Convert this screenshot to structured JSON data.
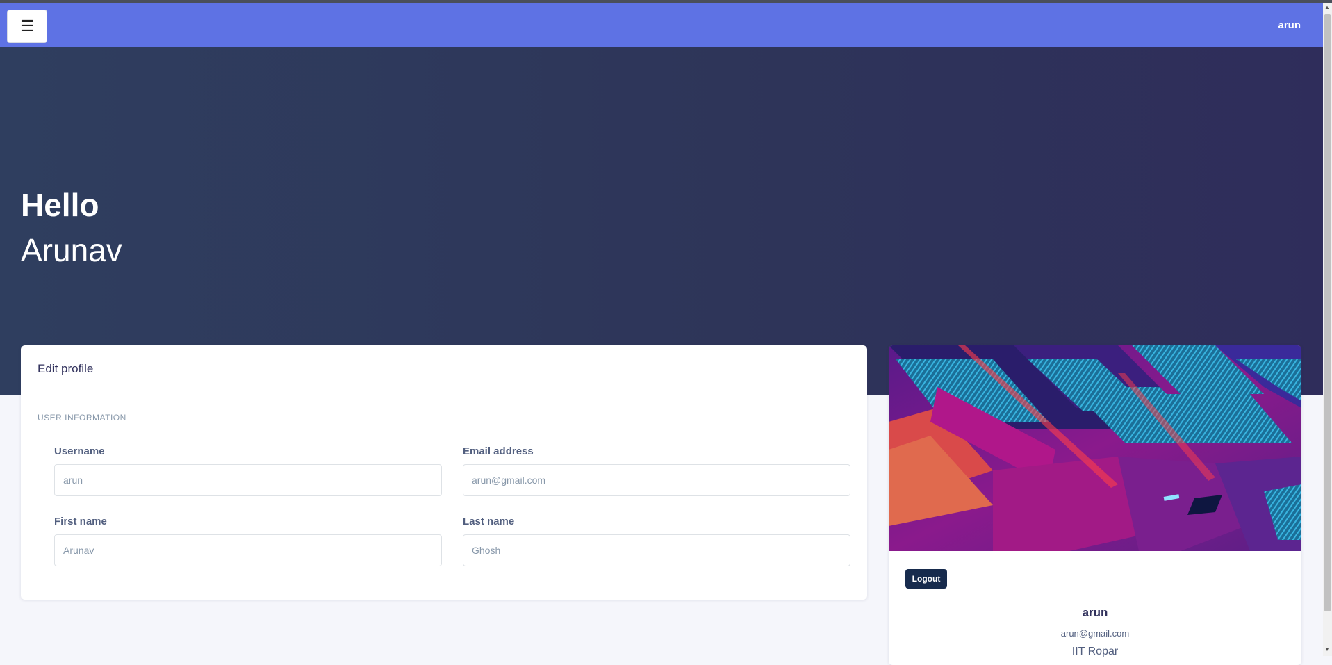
{
  "navbar": {
    "menu_icon": "hamburger-icon",
    "menu_glyph": "☰",
    "user": "arun",
    "color": "#5e72e4"
  },
  "hero": {
    "title": "Hello",
    "name": "Arunav"
  },
  "edit_profile": {
    "header": "Edit profile",
    "section_label": "USER INFORMATION",
    "fields": {
      "username": {
        "label": "Username",
        "placeholder": "arun"
      },
      "email": {
        "label": "Email address",
        "placeholder": "arun@gmail.com"
      },
      "first_name": {
        "label": "First name",
        "placeholder": "Arunav"
      },
      "last_name": {
        "label": "Last name",
        "placeholder": "Ghosh"
      }
    }
  },
  "profile_card": {
    "logout_label": "Logout",
    "username": "arun",
    "email": "arun@gmail.com",
    "institution": "IIT Ropar"
  }
}
